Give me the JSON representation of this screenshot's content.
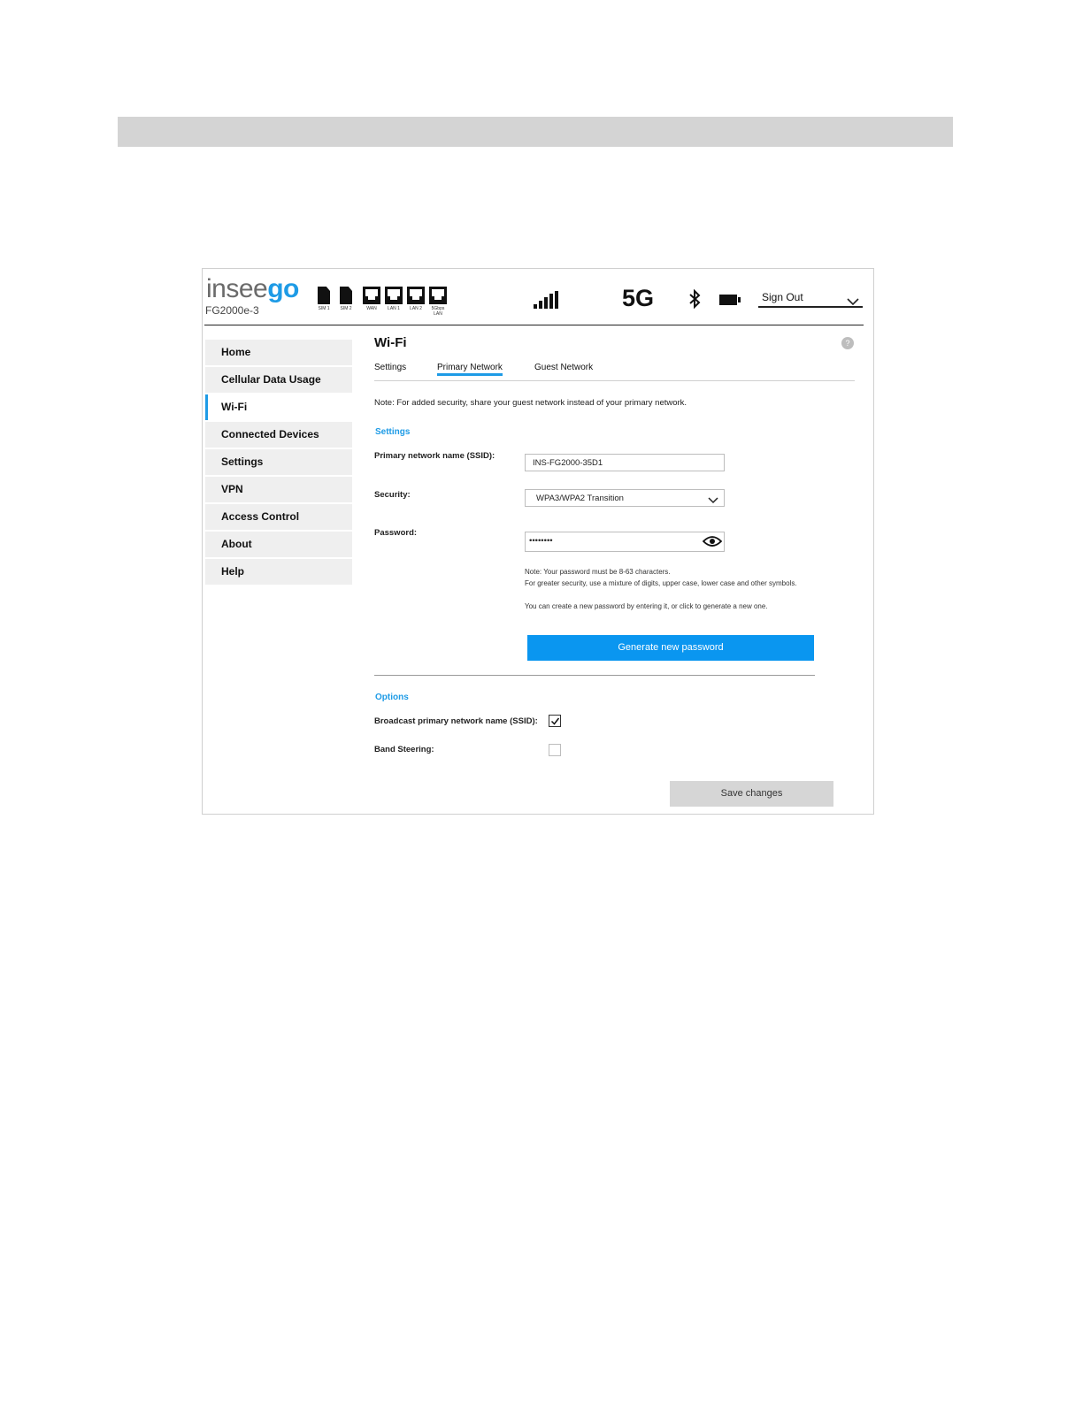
{
  "header": {
    "logo_part1": "insee",
    "logo_part2": "go",
    "model": "FG2000e-3",
    "ports": [
      {
        "label": "SIM 1",
        "kind": "sim"
      },
      {
        "label": "SIM 2",
        "kind": "sim"
      },
      {
        "label": "WAN",
        "kind": "eth"
      },
      {
        "label": "LAN 1",
        "kind": "eth"
      },
      {
        "label": "LAN 2",
        "kind": "eth"
      },
      {
        "label": "5Gbps LAN",
        "kind": "eth"
      }
    ],
    "network_type": "5G",
    "signout_label": "Sign Out",
    "icons": [
      "signal-bars-icon",
      "bluetooth-icon",
      "battery-icon",
      "chevron-down-icon"
    ]
  },
  "sidebar": {
    "items": [
      {
        "label": "Home",
        "active": false
      },
      {
        "label": "Cellular Data Usage",
        "active": false
      },
      {
        "label": "Wi-Fi",
        "active": true
      },
      {
        "label": "Connected Devices",
        "active": false
      },
      {
        "label": "Settings",
        "active": false
      },
      {
        "label": "VPN",
        "active": false
      },
      {
        "label": "Access Control",
        "active": false
      },
      {
        "label": "About",
        "active": false
      },
      {
        "label": "Help",
        "active": false
      }
    ]
  },
  "main": {
    "title": "Wi-Fi",
    "help_glyph": "?",
    "tabs": [
      {
        "label": "Settings",
        "active": false
      },
      {
        "label": "Primary Network",
        "active": true
      },
      {
        "label": "Guest Network",
        "active": false
      }
    ],
    "note": "Note: For added security, share your guest network instead of your primary network.",
    "settings_heading": "Settings",
    "ssid_label": "Primary network name (SSID):",
    "ssid_value": "INS-FG2000-35D1",
    "security_label": "Security:",
    "security_value": "WPA3/WPA2 Transition",
    "password_label": "Password:",
    "password_value": "••••••••",
    "password_note1": "Note: Your password must be 8-63 characters.",
    "password_note2": "For greater security, use a mixture of digits, upper case, lower case and other symbols.",
    "password_note3": "You can create a new password by entering it, or click to generate a new one.",
    "generate_label": "Generate new password",
    "options_heading": "Options",
    "broadcast_label": "Broadcast primary network name (SSID):",
    "broadcast_checked": true,
    "band_label": "Band Steering:",
    "band_checked": false,
    "save_label": "Save changes"
  },
  "colors": {
    "accent": "#1e9be6",
    "button_blue": "#0a96f0",
    "top_bar": "#d4d4d4",
    "nav_bg": "#efefef"
  }
}
